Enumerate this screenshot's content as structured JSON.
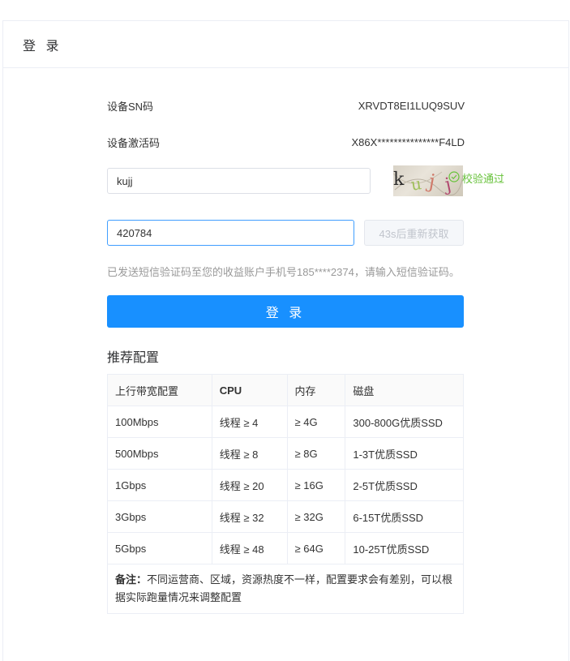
{
  "header": {
    "title": "登 录"
  },
  "device": {
    "sn_label": "设备SN码",
    "sn_value": "XRVDT8EI1LUQ9SUV",
    "activation_label": "设备激活码",
    "activation_value": "X86X***************F4LD"
  },
  "captcha": {
    "value": "kujj",
    "image_text": "kujj",
    "verified_text": "校验通过"
  },
  "sms": {
    "value": "420784",
    "resend_label": "43s后重新获取",
    "hint": "已发送短信验证码至您的收益账户手机号185****2374，请输入短信验证码。"
  },
  "login_button": "登 录",
  "recommend": {
    "title": "推荐配置",
    "columns": [
      "上行带宽配置",
      "CPU",
      "内存",
      "磁盘"
    ],
    "rows": [
      [
        "100Mbps",
        "线程 ≥ 4",
        "≥ 4G",
        "300-800G优质SSD"
      ],
      [
        "500Mbps",
        "线程 ≥ 8",
        "≥ 8G",
        "1-3T优质SSD"
      ],
      [
        "1Gbps",
        "线程 ≥ 20",
        "≥ 16G",
        "2-5T优质SSD"
      ],
      [
        "3Gbps",
        "线程 ≥ 32",
        "≥ 32G",
        "6-15T优质SSD"
      ],
      [
        "5Gbps",
        "线程 ≥ 48",
        "≥ 64G",
        "10-25T优质SSD"
      ]
    ],
    "note_label": "备注：",
    "note_text": "不同运营商、区域，资源热度不一样，配置要求会有差别，可以根据实际跑量情况来调整配置"
  },
  "colors": {
    "primary": "#1890ff",
    "success": "#67c23a",
    "focus_border": "#409eff"
  }
}
